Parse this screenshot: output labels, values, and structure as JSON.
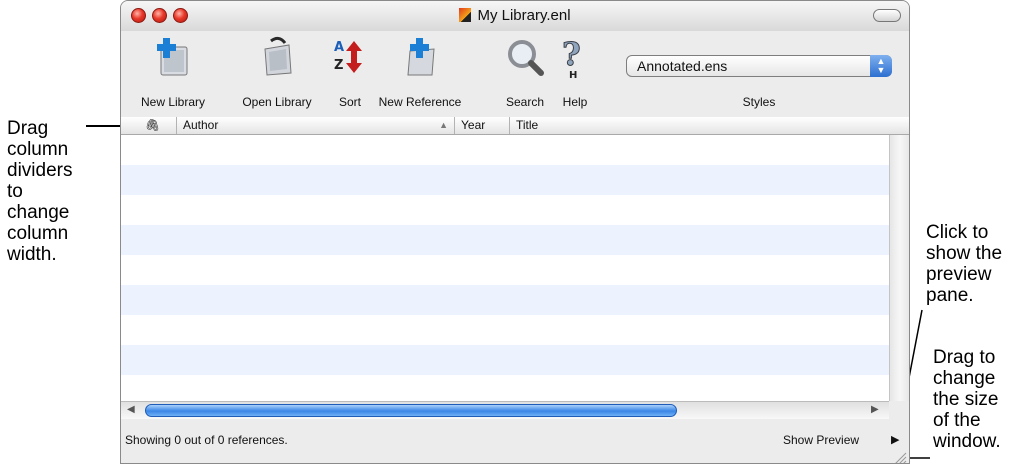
{
  "window": {
    "title": "My Library.enl"
  },
  "toolbar": {
    "buttons": [
      {
        "label": "New Library",
        "icon": "new-library-icon"
      },
      {
        "label": "Open Library",
        "icon": "open-library-icon"
      },
      {
        "label": "Sort",
        "icon": "sort-az-icon"
      },
      {
        "label": "New Reference",
        "icon": "new-reference-icon"
      },
      {
        "label": "Search",
        "icon": "magnifier-icon"
      },
      {
        "label": "Help",
        "icon": "help-icon"
      }
    ],
    "styles_value": "Annotated.ens",
    "styles_label": "Styles"
  },
  "columns": {
    "attachment": "🖇",
    "author": "Author",
    "sort_indicator": "▲",
    "year": "Year",
    "title": "Title"
  },
  "status": {
    "text": "Showing 0 out of 0 references.",
    "preview_button": "Show Preview"
  },
  "annotations": {
    "left": "Drag\ncolumn\ndividers\nto\nchange\ncolumn\nwidth.",
    "preview": "Click to\nshow the\npreview\npane.",
    "resize": "Drag to\nchange\nthe size\nof the\nwindow."
  },
  "colors": {
    "row_stripe": "#edf3fe",
    "scroll_thumb": "#3a86e6",
    "close_button": "#e8392a"
  }
}
